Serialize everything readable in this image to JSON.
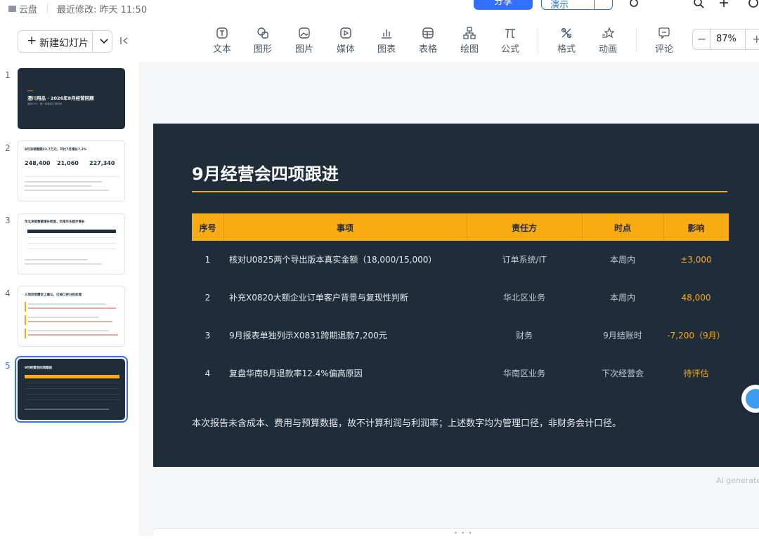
{
  "topbar": {
    "location": "云盘",
    "last_modified": "最近修改: 昨天 11:50",
    "share_label": "分享",
    "present_label": "演示"
  },
  "left_panel": {
    "new_slide_label": "新建幻灯片",
    "thumbnails": [
      {
        "num": "1",
        "title": "澄川用品 · 2026年8月经营回顾",
        "subtitle": "面向CEO · 周一经营会汇报材料"
      },
      {
        "num": "2",
        "title": "8月净销售额22.7万元，环比7月增长7.2%",
        "kpis": [
          "248,400",
          "21,060",
          "227,340"
        ]
      },
      {
        "num": "3",
        "title": "华北净销售额增长明显，华南华东稳步增长"
      },
      {
        "num": "4",
        "title": "三项异常需会上确认，已按口径分别处理"
      },
      {
        "num": "5",
        "title": "9月经营会四项跟进"
      }
    ],
    "selected_index": 5
  },
  "toolbar": {
    "tools": [
      {
        "label": "文本",
        "icon": "text-icon"
      },
      {
        "label": "图形",
        "icon": "shape-icon"
      },
      {
        "label": "图片",
        "icon": "image-icon"
      },
      {
        "label": "媒体",
        "icon": "media-icon"
      },
      {
        "label": "图表",
        "icon": "chart-icon"
      },
      {
        "label": "表格",
        "icon": "table-icon"
      },
      {
        "label": "绘图",
        "icon": "diagram-icon"
      },
      {
        "label": "公式",
        "icon": "formula-icon"
      },
      {
        "label": "格式",
        "icon": "format-icon"
      },
      {
        "label": "动画",
        "icon": "animation-icon"
      },
      {
        "label": "评论",
        "icon": "comment-icon"
      }
    ],
    "zoom": "87%"
  },
  "slide": {
    "title": "9月经营会四项跟进",
    "headers": [
      "序号",
      "事项",
      "责任方",
      "时点",
      "影响"
    ],
    "rows": [
      {
        "no": "1",
        "item": "核对U0825两个导出版本真实金额（18,000/15,000）",
        "owner": "订单系统/IT",
        "when": "本周内",
        "impact": "±3,000"
      },
      {
        "no": "2",
        "item": "补充X0820大额企业订单客户背景与复现性判断",
        "owner": "华北区业务",
        "when": "本周内",
        "impact": "48,000"
      },
      {
        "no": "3",
        "item": "9月报表单独列示X0831跨期退款7,200元",
        "owner": "财务",
        "when": "9月结账时",
        "impact": "-7,200（9月）"
      },
      {
        "no": "4",
        "item": "复盘华南8月退款率12.4%偏高原因",
        "owner": "华南区业务",
        "when": "下次经营会",
        "impact": "待评估"
      }
    ],
    "note": "本次报告未含成本、费用与预算数据，故不计算利润与利润率；上述数字均为管理口径，非财务会计口径。"
  },
  "canvas": {
    "ai_generated": "AI generated"
  },
  "colors": {
    "slide_bg": "#1f2d3a",
    "accent": "#f8ac12",
    "primary": "#3370ff"
  }
}
